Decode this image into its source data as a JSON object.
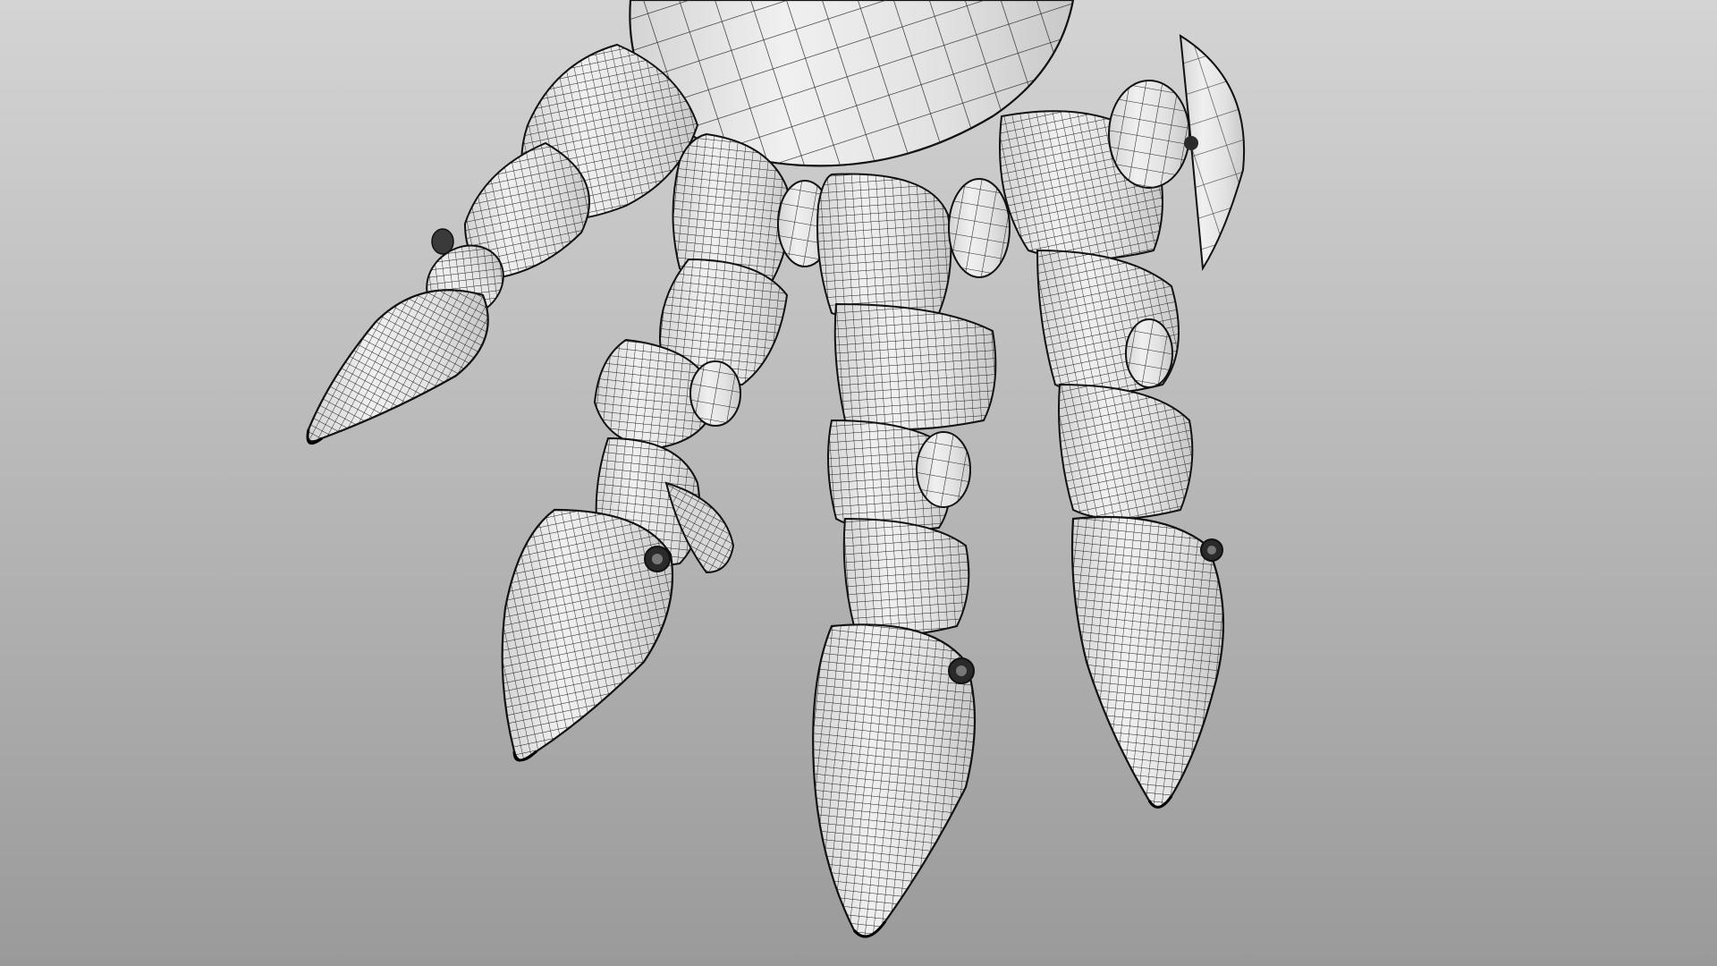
{
  "scene": {
    "subject": "wireframe-robot-hand",
    "render_mode": "wireframe",
    "colors": {
      "background_top": "#d2d2d2",
      "background_bottom": "#9a9a9a",
      "surface_light": "#eeeeee",
      "surface_mid": "#dedede",
      "surface_shade": "#c6c6c6",
      "wire": "#1c1c1c",
      "outline": "#0d0d0d"
    }
  }
}
